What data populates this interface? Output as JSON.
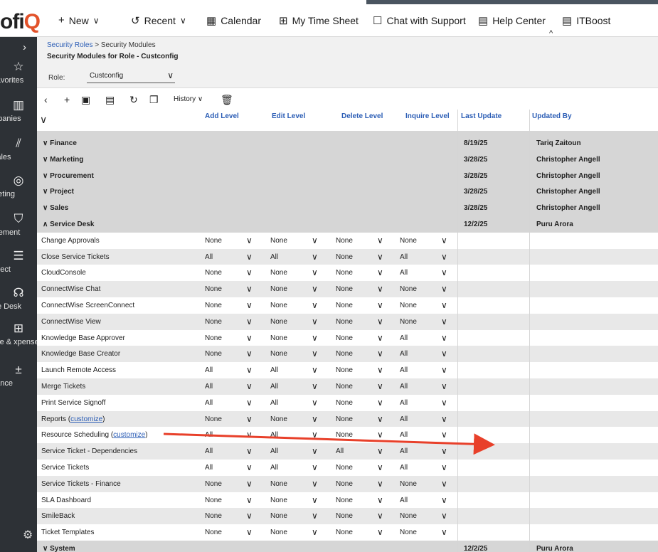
{
  "brand": {
    "logo_text": "ofi",
    "logo_q": "Q"
  },
  "topnav": [
    {
      "icon": "+",
      "label": "New",
      "chev": "∨"
    },
    {
      "icon": "↺",
      "label": "Recent",
      "chev": "∨"
    },
    {
      "icon": "▦",
      "label": "Calendar",
      "chev": ""
    },
    {
      "icon": "⊞",
      "label": "My Time Sheet",
      "chev": ""
    },
    {
      "icon": "☐",
      "label": "Chat with Support",
      "chev": ""
    },
    {
      "icon": "▤",
      "label": "Help Center",
      "chev": ""
    },
    {
      "icon": "▤",
      "label": "ITBoost",
      "chev": ""
    }
  ],
  "sidebar": {
    "items": [
      {
        "icon": "☆",
        "label": "Favorites"
      },
      {
        "icon": "▥",
        "label": "mpanies"
      },
      {
        "icon": "⫽",
        "label": "Sales"
      },
      {
        "icon": "◎",
        "label": "rketing"
      },
      {
        "icon": "⛉",
        "label": "urement"
      },
      {
        "icon": "☰",
        "label": "roject"
      },
      {
        "icon": "☊",
        "label": "ice Desk"
      },
      {
        "icon": "⊞",
        "label": "ime & xpense"
      },
      {
        "icon": "±",
        "label": "nance"
      }
    ]
  },
  "breadcrumb": {
    "parent": "Security Roles",
    "sep": ">",
    "current": "Security Modules"
  },
  "page_title": "Security Modules for Role - Custconfig",
  "role": {
    "label": "Role:",
    "value": "Custconfig"
  },
  "toolbar": {
    "history_label": "History"
  },
  "columns": {
    "add": "Add Level",
    "edit": "Edit Level",
    "delete": "Delete Level",
    "inquire": "Inquire Level",
    "last_update": "Last Update",
    "updated_by": "Updated By"
  },
  "groups_top": [
    {
      "name": "Finance",
      "expanded": false,
      "last_update": "8/19/25",
      "updated_by": "Tariq Zaitoun"
    },
    {
      "name": "Marketing",
      "expanded": false,
      "last_update": "3/28/25",
      "updated_by": "Christopher Angell"
    },
    {
      "name": "Procurement",
      "expanded": false,
      "last_update": "3/28/25",
      "updated_by": "Christopher Angell"
    },
    {
      "name": "Project",
      "expanded": false,
      "last_update": "3/28/25",
      "updated_by": "Christopher Angell"
    },
    {
      "name": "Sales",
      "expanded": false,
      "last_update": "3/28/25",
      "updated_by": "Christopher Angell"
    },
    {
      "name": "Service Desk",
      "expanded": true,
      "last_update": "12/2/25",
      "updated_by": "Puru Arora"
    }
  ],
  "modules": [
    {
      "name": "Change Approvals",
      "link": "",
      "add": "None",
      "edit": "None",
      "delete": "None",
      "inquire": "None"
    },
    {
      "name": "Close Service Tickets",
      "link": "",
      "add": "All",
      "edit": "All",
      "delete": "None",
      "inquire": "All"
    },
    {
      "name": "CloudConsole",
      "link": "",
      "add": "None",
      "edit": "None",
      "delete": "None",
      "inquire": "All"
    },
    {
      "name": "ConnectWise Chat",
      "link": "",
      "add": "None",
      "edit": "None",
      "delete": "None",
      "inquire": "None"
    },
    {
      "name": "ConnectWise ScreenConnect",
      "link": "",
      "add": "None",
      "edit": "None",
      "delete": "None",
      "inquire": "None"
    },
    {
      "name": "ConnectWise View",
      "link": "",
      "add": "None",
      "edit": "None",
      "delete": "None",
      "inquire": "None"
    },
    {
      "name": "Knowledge Base Approver",
      "link": "",
      "add": "None",
      "edit": "None",
      "delete": "None",
      "inquire": "All"
    },
    {
      "name": "Knowledge Base Creator",
      "link": "",
      "add": "None",
      "edit": "None",
      "delete": "None",
      "inquire": "All"
    },
    {
      "name": "Launch Remote Access",
      "link": "",
      "add": "All",
      "edit": "All",
      "delete": "None",
      "inquire": "All"
    },
    {
      "name": "Merge Tickets",
      "link": "",
      "add": "All",
      "edit": "All",
      "delete": "None",
      "inquire": "All"
    },
    {
      "name": "Print Service Signoff",
      "link": "",
      "add": "All",
      "edit": "All",
      "delete": "None",
      "inquire": "All"
    },
    {
      "name": "Reports",
      "link": "customize",
      "add": "None",
      "edit": "None",
      "delete": "None",
      "inquire": "All"
    },
    {
      "name": "Resource Scheduling",
      "link": "customize",
      "add": "All",
      "edit": "All",
      "delete": "None",
      "inquire": "All"
    },
    {
      "name": "Service Ticket - Dependencies",
      "link": "",
      "add": "All",
      "edit": "All",
      "delete": "All",
      "inquire": "All"
    },
    {
      "name": "Service Tickets",
      "link": "",
      "add": "All",
      "edit": "All",
      "delete": "None",
      "inquire": "All"
    },
    {
      "name": "Service Tickets - Finance",
      "link": "",
      "add": "None",
      "edit": "None",
      "delete": "None",
      "inquire": "None"
    },
    {
      "name": "SLA Dashboard",
      "link": "",
      "add": "None",
      "edit": "None",
      "delete": "None",
      "inquire": "All"
    },
    {
      "name": "SmileBack",
      "link": "",
      "add": "None",
      "edit": "None",
      "delete": "None",
      "inquire": "None"
    },
    {
      "name": "Ticket Templates",
      "link": "",
      "add": "None",
      "edit": "None",
      "delete": "None",
      "inquire": "None"
    }
  ],
  "groups_bottom": [
    {
      "name": "System",
      "expanded": false,
      "last_update": "12/2/25",
      "updated_by": "Puru Arora"
    }
  ],
  "colors": {
    "accent": "#2b5db5",
    "brand_q": "#e2522a",
    "annotation_arrow": "#e8402a",
    "sidebar": "#2d3136"
  },
  "annotation": {
    "type": "arrow",
    "target": "Resource Scheduling (customize)"
  }
}
